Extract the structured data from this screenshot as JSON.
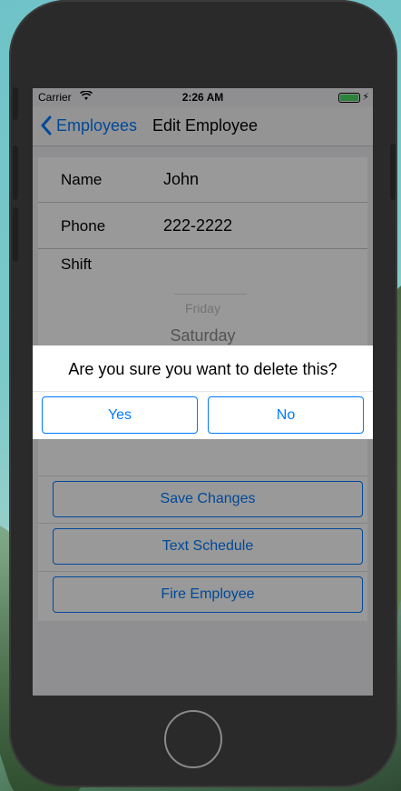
{
  "status_bar": {
    "carrier": "Carrier",
    "time": "2:26 AM",
    "battery_color": "#4cd964"
  },
  "nav": {
    "back_label": "Employees",
    "title": "Edit Employee"
  },
  "form": {
    "name_label": "Name",
    "name_value": "John",
    "phone_label": "Phone",
    "phone_value": "222-2222",
    "shift_label": "Shift",
    "picker_items": [
      "Friday",
      "Saturday"
    ]
  },
  "actions": {
    "save_label": "Save Changes",
    "text_label": "Text Schedule",
    "fire_label": "Fire Employee"
  },
  "alert": {
    "message": "Are you sure you want to delete this?",
    "yes_label": "Yes",
    "no_label": "No"
  },
  "colors": {
    "accent": "#007aff"
  }
}
